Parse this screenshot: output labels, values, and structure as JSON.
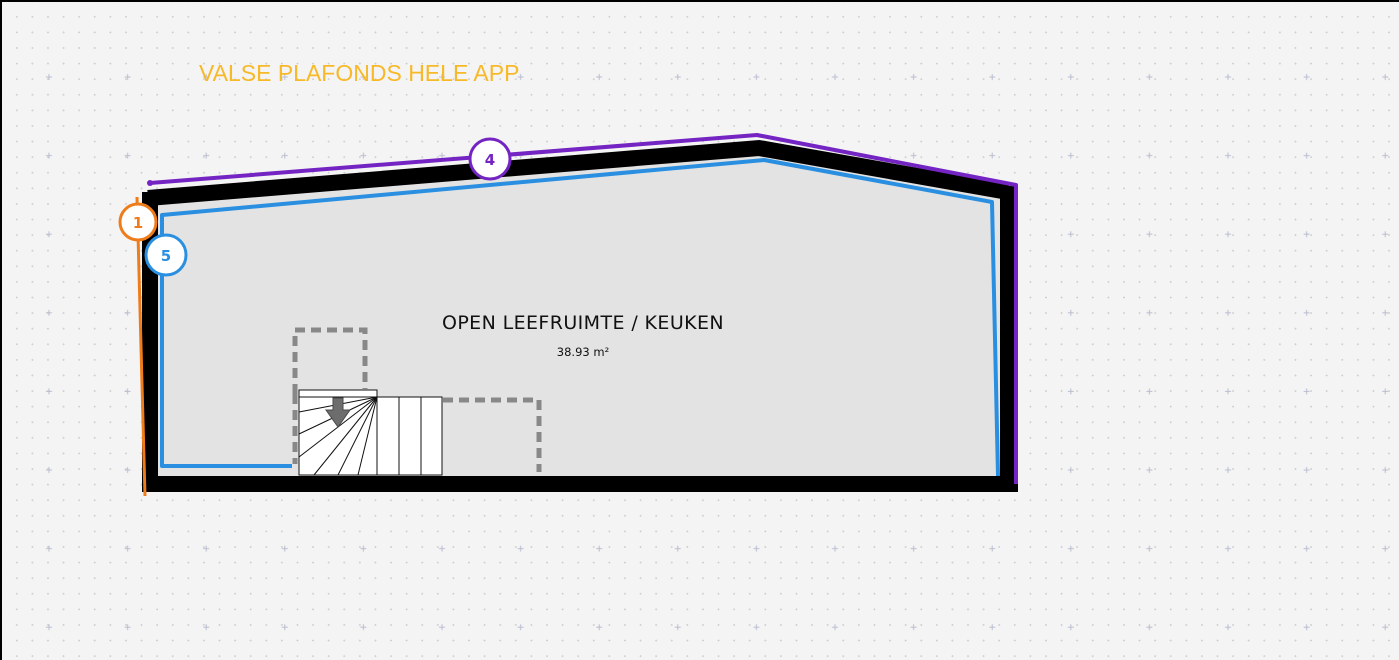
{
  "title": "VALSE PLAFONDS HELE APP",
  "room": {
    "name": "OPEN LEEFRUIMTE / KEUKEN",
    "area": "38.93 m²"
  },
  "badges": [
    {
      "label": "1",
      "color": "#ef7c1a"
    },
    {
      "label": "5",
      "color": "#2a8fe0"
    },
    {
      "label": "4",
      "color": "#7324c2"
    }
  ],
  "colors": {
    "background": "#f4f4f4",
    "wall": "#000000",
    "room_fill": "#e3e3e3",
    "line_orange": "#ef7c1a",
    "line_blue": "#2a8fe0",
    "line_purple": "#7324c2",
    "title": "#f7b928",
    "dashed": "#888888"
  },
  "icons": [
    "stair-arrow-down-icon"
  ]
}
